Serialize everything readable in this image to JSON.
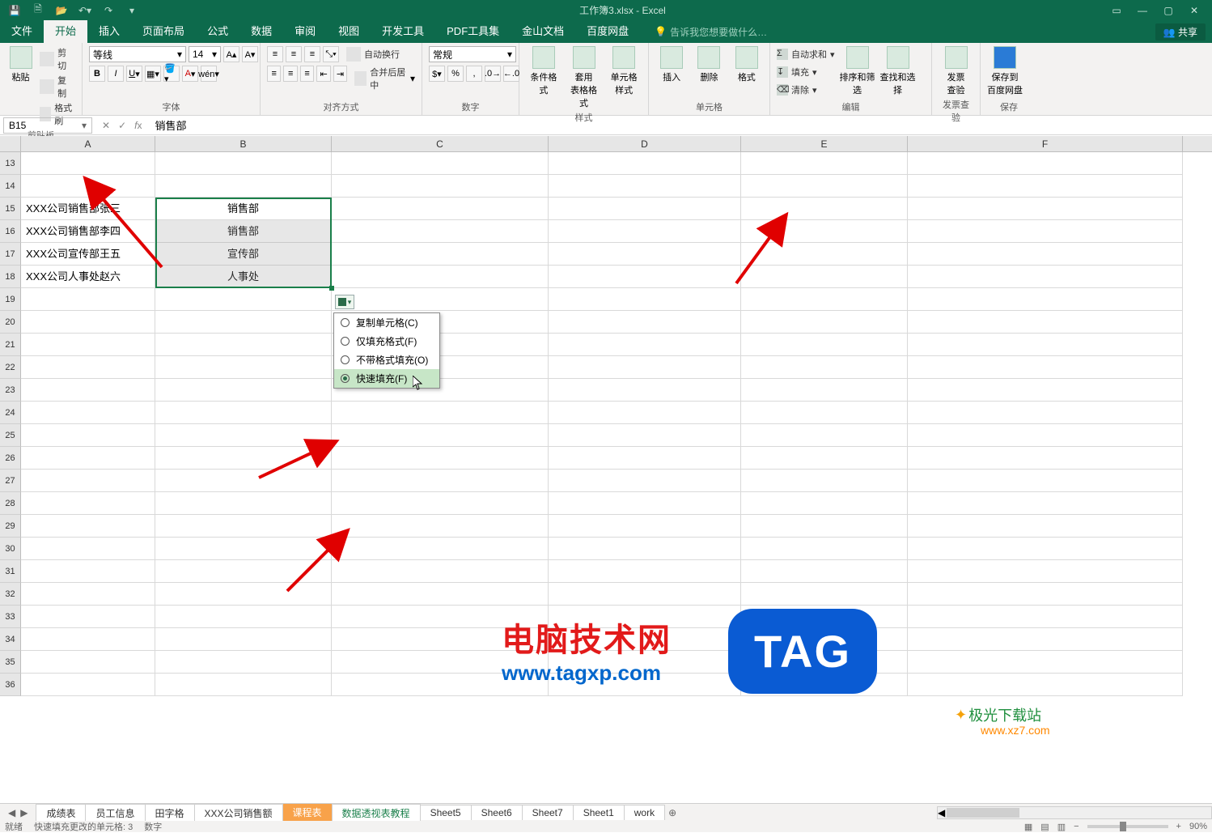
{
  "title": "工作簿3.xlsx - Excel",
  "quick_access": {
    "icons": [
      "save",
      "save-as",
      "open",
      "undo",
      "redo",
      "touch-mode",
      "more"
    ]
  },
  "menu_tabs": [
    "文件",
    "开始",
    "插入",
    "页面布局",
    "公式",
    "数据",
    "审阅",
    "视图",
    "开发工具",
    "PDF工具集",
    "金山文档",
    "百度网盘"
  ],
  "menu_active_index": 1,
  "help_prompt": "告诉我您想要做什么…",
  "share_label": "共享",
  "ribbon": {
    "clipboard": {
      "paste": "粘贴",
      "cut": "剪切",
      "copy": "复制",
      "format_painter": "格式刷",
      "group": "剪贴板"
    },
    "font": {
      "name": "等线",
      "size": "14",
      "group": "字体"
    },
    "alignment": {
      "wrap": "自动换行",
      "merge": "合并后居中",
      "group": "对齐方式"
    },
    "number": {
      "format": "常规",
      "group": "数字"
    },
    "styles": {
      "cond": "条件格式",
      "table": "套用\n表格格式",
      "cell": "单元格样式",
      "group": "样式"
    },
    "cells": {
      "insert": "插入",
      "delete": "删除",
      "format": "格式",
      "group": "单元格"
    },
    "editing": {
      "sum": "自动求和",
      "fill": "填充",
      "clear": "清除",
      "sort": "排序和筛选",
      "find": "查找和选择",
      "group": "编辑"
    },
    "invoice": {
      "label": "发票\n查验",
      "group": "发票查验"
    },
    "baidu": {
      "label": "保存到\n百度网盘",
      "group": "保存"
    }
  },
  "name_box": "B15",
  "formula_value": "销售部",
  "columns": [
    "A",
    "B",
    "C",
    "D",
    "E",
    "F"
  ],
  "row_start": 13,
  "row_count": 24,
  "data_rows": [
    {
      "r": 15,
      "a": "XXX公司销售部张三",
      "b": "销售部"
    },
    {
      "r": 16,
      "a": "XXX公司销售部李四",
      "b": "销售部"
    },
    {
      "r": 17,
      "a": "XXX公司宣传部王五",
      "b": "宣传部"
    },
    {
      "r": 18,
      "a": "XXX公司人事处赵六",
      "b": "人事处"
    }
  ],
  "fill_menu": {
    "items": [
      {
        "key": "copy",
        "label": "复制单元格(C)"
      },
      {
        "key": "fmt",
        "label": "仅填充格式(F)"
      },
      {
        "key": "nofmt",
        "label": "不带格式填充(O)"
      },
      {
        "key": "flash",
        "label": "快速填充(F)"
      }
    ],
    "selected_index": 3
  },
  "sheet_tabs": [
    "成绩表",
    "员工信息",
    "田字格",
    "XXX公司销售额",
    "课程表",
    "数据透视表教程",
    "Sheet5",
    "Sheet6",
    "Sheet7",
    "Sheet1",
    "work"
  ],
  "sheet_active_index": 4,
  "sheet_highlight_index": 3,
  "status_bar": {
    "ready": "就绪",
    "msg": "快速填充更改的单元格: 3",
    "count_label": "数字",
    "zoom": "90%"
  },
  "watermark": {
    "name": "电脑技术网",
    "url": "www.tagxp.com",
    "tag": "TAG",
    "jg": "极光下载站",
    "xz": "www.xz7.com"
  }
}
